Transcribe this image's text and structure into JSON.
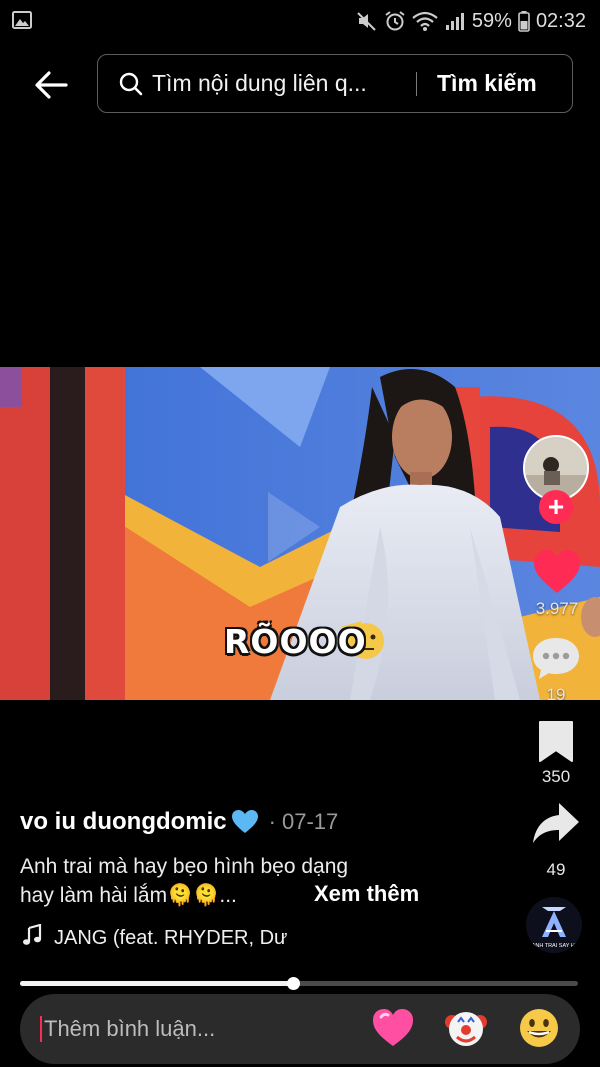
{
  "status_bar": {
    "battery": "59%",
    "time": "02:32",
    "icons": [
      "gallery-icon",
      "mute-icon",
      "alarm-icon",
      "wifi-icon",
      "signal-icon",
      "battery-icon"
    ]
  },
  "header": {
    "back_icon": "back-arrow-icon",
    "search_icon": "search-icon",
    "search_query": "Tìm nội dung liên q...",
    "search_button": "Tìm kiếm"
  },
  "video": {
    "caption_overlay": "RÕOOO"
  },
  "actions": {
    "likes": "3.977",
    "comments": "19",
    "saves": "350",
    "shares": "49"
  },
  "post": {
    "username": "vo iu duongdomic",
    "separator": "·",
    "date": "07-17",
    "description_line1": "Anh trai mà hay bẹo hình bẹo dạng",
    "description_line2": "hay làm hài lắm🫠🫠...",
    "see_more": "Xem thêm",
    "music": "JANG (feat. RHYDER, Dư"
  },
  "music_disc": {
    "label": "ANH TRAI SAY HI"
  },
  "progress": {
    "fraction": 0.49
  },
  "comment_bar": {
    "placeholder": "Thêm bình luận...",
    "emojis": [
      "heart-emoji",
      "clown-emoji",
      "grin-emoji"
    ]
  },
  "colors": {
    "background": "#000000",
    "accent_red": "#fe2c55",
    "like_red": "#fe2c55",
    "muted_text": "#9a9a9a"
  }
}
